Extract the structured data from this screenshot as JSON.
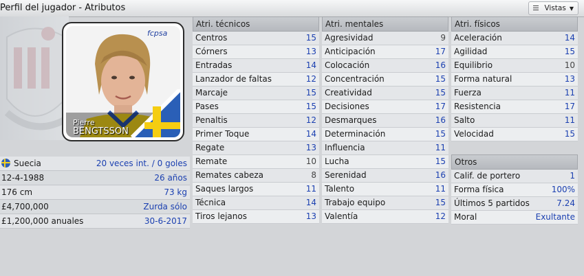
{
  "header": {
    "title": "Perfil del jugador - Atributos",
    "vistas": "Vistas"
  },
  "player": {
    "first_name": "Pierre",
    "last_name": "BENGTSSON"
  },
  "info": [
    {
      "label": "Suecia",
      "value": "20 veces int. / 0 goles"
    },
    {
      "label": "12-4-1988",
      "value": "26 años"
    },
    {
      "label": "176 cm",
      "value": "73 kg"
    },
    {
      "label": "£4,700,000",
      "value": "Zurda sólo"
    },
    {
      "label": "£1,200,000 anuales",
      "value": "30-6-2017"
    }
  ],
  "tecnicos": {
    "title": "Atri. técnicos",
    "rows": [
      {
        "label": "Centros",
        "value": "15"
      },
      {
        "label": "Córners",
        "value": "13"
      },
      {
        "label": "Entradas",
        "value": "14"
      },
      {
        "label": "Lanzador de faltas",
        "value": "12"
      },
      {
        "label": "Marcaje",
        "value": "15"
      },
      {
        "label": "Pases",
        "value": "15"
      },
      {
        "label": "Penaltis",
        "value": "12"
      },
      {
        "label": "Primer Toque",
        "value": "14"
      },
      {
        "label": "Regate",
        "value": "13"
      },
      {
        "label": "Remate",
        "value": "10"
      },
      {
        "label": "Remates cabeza",
        "value": "8"
      },
      {
        "label": "Saques largos",
        "value": "11"
      },
      {
        "label": "Técnica",
        "value": "14"
      },
      {
        "label": "Tiros lejanos",
        "value": "13"
      }
    ]
  },
  "mentales": {
    "title": "Atri. mentales",
    "rows": [
      {
        "label": "Agresividad",
        "value": "9"
      },
      {
        "label": "Anticipación",
        "value": "17"
      },
      {
        "label": "Colocación",
        "value": "16"
      },
      {
        "label": "Concentración",
        "value": "15"
      },
      {
        "label": "Creatividad",
        "value": "15"
      },
      {
        "label": "Decisiones",
        "value": "17"
      },
      {
        "label": "Desmarques",
        "value": "16"
      },
      {
        "label": "Determinación",
        "value": "15"
      },
      {
        "label": "Influencia",
        "value": "11"
      },
      {
        "label": "Lucha",
        "value": "15"
      },
      {
        "label": "Serenidad",
        "value": "16"
      },
      {
        "label": "Talento",
        "value": "11"
      },
      {
        "label": "Trabajo equipo",
        "value": "15"
      },
      {
        "label": "Valentía",
        "value": "12"
      }
    ]
  },
  "fisicos": {
    "title": "Atri. físicos",
    "rows": [
      {
        "label": "Aceleración",
        "value": "14"
      },
      {
        "label": "Agilidad",
        "value": "15"
      },
      {
        "label": "Equilibrio",
        "value": "10"
      },
      {
        "label": "Forma natural",
        "value": "13"
      },
      {
        "label": "Fuerza",
        "value": "11"
      },
      {
        "label": "Resistencia",
        "value": "17"
      },
      {
        "label": "Salto",
        "value": "11"
      },
      {
        "label": "Velocidad",
        "value": "15"
      }
    ]
  },
  "otros": {
    "title": "Otros",
    "rows": [
      {
        "label": "Calif. de portero",
        "value": "1"
      },
      {
        "label": "Forma física",
        "value": "100%"
      },
      {
        "label": "Últimos 5 partidos",
        "value": "7.24"
      },
      {
        "label": "Moral",
        "value": "Exultante"
      }
    ]
  },
  "colors": {
    "value_blue": "#1a3fb0",
    "value_gray": "#444444",
    "header_bg": "#b6b9be"
  }
}
